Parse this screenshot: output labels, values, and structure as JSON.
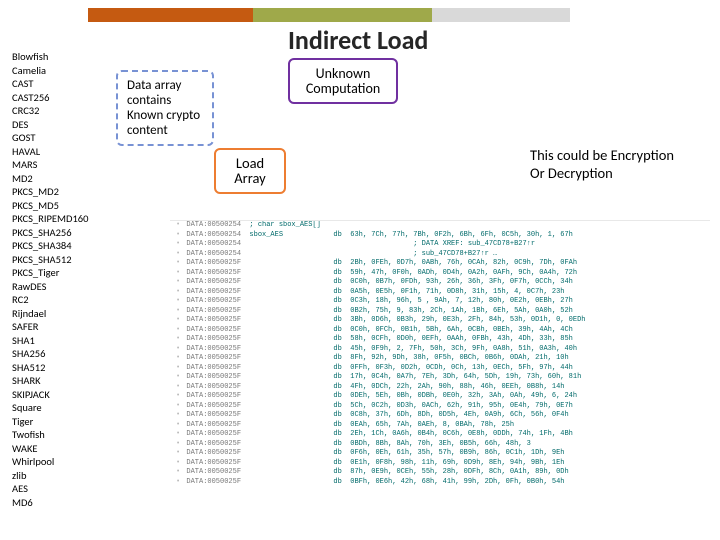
{
  "title": "Indirect Load",
  "algos": [
    "Blowfish",
    "Camelia",
    "CAST",
    "CAST256",
    "CRC32",
    "DES",
    "GOST",
    "HAVAL",
    "MARS",
    "MD2",
    "PKCS_MD2",
    "PKCS_MD5",
    "PKCS_RIPEMD160",
    "PKCS_SHA256",
    "PKCS_SHA384",
    "PKCS_SHA512",
    "PKCS_Tiger",
    "RawDES",
    "RC2",
    "Rijndael",
    "SAFER",
    "SHA1",
    "SHA256",
    "SHA512",
    "SHARK",
    "SKIPJACK",
    "Square",
    "Tiger",
    "Twofish",
    "WAKE",
    "Whirlpool",
    "zlib",
    "AES",
    "MD6"
  ],
  "box_dataarray": "Data array contains Known crypto content",
  "box_unknown": "Unknown Computation",
  "box_load": "Load Array",
  "conclusion_l1": "This could be Encryption",
  "conclusion_l2": "Or Decryption",
  "listing_rows": [
    {
      "addr": "DATA:00500254",
      "txt": "; char sbox_AES[]"
    },
    {
      "addr": "DATA:00500254",
      "txt": "sbox_AES            db  63h, 7Ch, 77h, 7Bh, 0F2h, 6Bh, 6Fh, 0C5h, 30h, 1, 67h"
    },
    {
      "addr": "DATA:00500254",
      "txt": "                                       ; DATA XREF: sub_47CD78+B27↑r"
    },
    {
      "addr": "DATA:00500254",
      "txt": "                                       ; sub_47CD78+B27↑r …"
    },
    {
      "addr": "DATA:0050025F",
      "txt": "                    db  2Bh, 0FEh, 0D7h, 0ABh, 76h, 0CAh, 82h, 0C9h, 7Dh, 0FAh"
    },
    {
      "addr": "DATA:0050025F",
      "txt": "                    db  59h, 47h, 0F0h, 0ADh, 0D4h, 0A2h, 0AFh, 9Ch, 0A4h, 72h"
    },
    {
      "addr": "DATA:0050025F",
      "txt": "                    db  0C0h, 0B7h, 0FDh, 93h, 26h, 36h, 3Fh, 0F7h, 0CCh, 34h"
    },
    {
      "addr": "DATA:0050025F",
      "txt": "                    db  0A5h, 0E5h, 0F1h, 71h, 0D8h, 31h, 15h, 4, 0C7h, 23h"
    },
    {
      "addr": "DATA:0050025F",
      "txt": "                    db  0C3h, 18h, 96h, 5 , 9Ah, 7, 12h, 80h, 0E2h, 0EBh, 27h"
    },
    {
      "addr": "DATA:0050025F",
      "txt": "                    db  0B2h, 75h, 9, 83h, 2Ch, 1Ah, 1Bh, 6Eh, 5Ah, 0A0h, 52h"
    },
    {
      "addr": "DATA:0050025F",
      "txt": "                    db  3Bh, 0D6h, 0B3h, 29h, 0E3h, 2Fh, 84h, 53h, 0D1h, 0, 0EDh"
    },
    {
      "addr": "DATA:0050025F",
      "txt": "                    db  0C0h, 0FCh, 0B1h, 5Bh, 6Ah, 0CBh, 0BEh, 39h, 4Ah, 4Ch"
    },
    {
      "addr": "DATA:0050025F",
      "txt": "                    db  58h, 0CFh, 0D0h, 0EFh, 0AAh, 0FBh, 43h, 4Dh, 33h, 85h"
    },
    {
      "addr": "DATA:0050025F",
      "txt": "                    db  45h, 0F9h, 2, 7Fh, 50h, 3Ch, 9Fh, 0A8h, 51h, 0A3h, 40h"
    },
    {
      "addr": "DATA:0050025F",
      "txt": "                    db  8Fh, 92h, 9Dh, 38h, 0F5h, 0BCh, 0B6h, 0DAh, 21h, 10h"
    },
    {
      "addr": "DATA:0050025F",
      "txt": "                    db  0FFh, 0F3h, 0D2h, 0CDh, 0Ch, 13h, 0ECh, 5Fh, 97h, 44h"
    },
    {
      "addr": "DATA:0050025F",
      "txt": "                    db  17h, 0C4h, 0A7h, 7Eh, 3Dh, 64h, 5Dh, 19h, 73h, 60h, 81h"
    },
    {
      "addr": "DATA:0050025F",
      "txt": "                    db  4Fh, 0DCh, 22h, 2Ah, 90h, 88h, 46h, 0EEh, 0B8h, 14h"
    },
    {
      "addr": "DATA:0050025F",
      "txt": "                    db  0DEh, 5Eh, 0Bh, 0DBh, 0E0h, 32h, 3Ah, 0Ah, 49h, 6, 24h"
    },
    {
      "addr": "DATA:0050025F",
      "txt": "                    db  5Ch, 0C2h, 0D3h, 0ACh, 62h, 91h, 95h, 0E4h, 79h, 0E7h"
    },
    {
      "addr": "DATA:0050025F",
      "txt": "                    db  0C8h, 37h, 6Dh, 8Dh, 0D5h, 4Eh, 0A9h, 6Ch, 56h, 0F4h"
    },
    {
      "addr": "DATA:0050025F",
      "txt": "                    db  0EAh, 65h, 7Ah, 0AEh, 8, 0BAh, 78h, 25h"
    },
    {
      "addr": "DATA:0050025F",
      "txt": "                    db  2Eh, 1Ch, 0A6h, 0B4h, 0C6h, 0E8h, 0DDh, 74h, 1Fh, 4Bh"
    },
    {
      "addr": "DATA:0050025F",
      "txt": "                    db  0BDh, 8Bh, 8Ah, 70h, 3Eh, 0B5h, 66h, 48h, 3"
    },
    {
      "addr": "DATA:0050025F",
      "txt": "                    db  0F6h, 0Eh, 61h, 35h, 57h, 0B9h, 86h, 0C1h, 1Dh, 9Eh"
    },
    {
      "addr": "DATA:0050025F",
      "txt": "                    db  0E1h, 0F8h, 98h, 11h, 69h, 0D9h, 8Eh, 94h, 9Bh, 1Eh"
    },
    {
      "addr": "DATA:0050025F",
      "txt": "                    db  87h, 0E9h, 0CEh, 55h, 28h, 0DFh, 8Ch, 0A1h, 89h, 0Dh"
    },
    {
      "addr": "DATA:0050025F",
      "txt": "                    db  0BFh, 0E6h, 42h, 68h, 41h, 99h, 2Dh, 0Fh, 0B0h, 54h"
    }
  ]
}
